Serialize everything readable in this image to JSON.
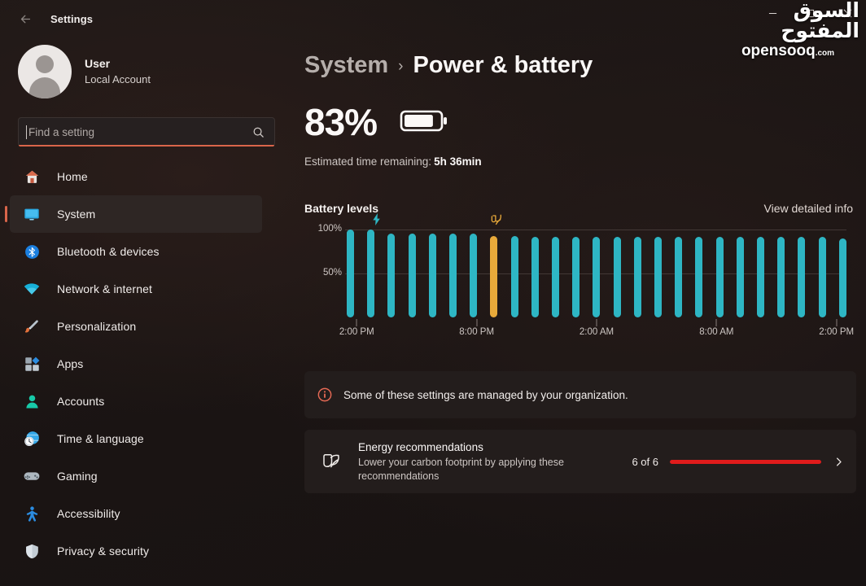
{
  "window": {
    "title": "Settings",
    "back_icon": "back-arrow-icon",
    "controls": [
      {
        "name": "minimize-button",
        "glyph": "─"
      },
      {
        "name": "maximize-button",
        "glyph": "□"
      },
      {
        "name": "close-button",
        "glyph": "✕"
      }
    ]
  },
  "watermark": {
    "arabic": "السوق المفتوح",
    "english": "opensooq",
    "suffix": ".com"
  },
  "sidebar": {
    "account": {
      "name": "User",
      "subtitle": "Local Account",
      "avatar_icon": "user-avatar-icon"
    },
    "search": {
      "placeholder": "Find a setting",
      "value": "",
      "icon": "search-icon"
    },
    "items": [
      {
        "label": "Home",
        "icon": "home-icon",
        "selected": false
      },
      {
        "label": "System",
        "icon": "system-monitor-icon",
        "selected": true
      },
      {
        "label": "Bluetooth & devices",
        "icon": "bluetooth-icon",
        "selected": false
      },
      {
        "label": "Network & internet",
        "icon": "wifi-icon",
        "selected": false
      },
      {
        "label": "Personalization",
        "icon": "paintbrush-icon",
        "selected": false
      },
      {
        "label": "Apps",
        "icon": "apps-icon",
        "selected": false
      },
      {
        "label": "Accounts",
        "icon": "accounts-person-icon",
        "selected": false
      },
      {
        "label": "Time & language",
        "icon": "clock-globe-icon",
        "selected": false
      },
      {
        "label": "Gaming",
        "icon": "gamepad-icon",
        "selected": false
      },
      {
        "label": "Accessibility",
        "icon": "accessibility-person-icon",
        "selected": false
      },
      {
        "label": "Privacy & security",
        "icon": "shield-icon",
        "selected": false
      }
    ]
  },
  "main": {
    "breadcrumb": {
      "parent": "System",
      "separator": "›",
      "current": "Power & battery"
    },
    "battery": {
      "percent_label": "83%",
      "percent_value": 83,
      "icon": "battery-icon",
      "estimate_label": "Estimated time remaining:",
      "estimate_value": "5h 36min"
    },
    "chart_section": {
      "title": "Battery levels",
      "link": "View detailed info"
    },
    "org_banner": {
      "icon": "info-icon",
      "text": "Some of these settings are managed by your organization."
    },
    "energy_card": {
      "icon": "energy-leaf-icon",
      "title": "Energy recommendations",
      "subtitle": "Lower your carbon footprint by applying these recommendations",
      "count": "6 of 6",
      "progress_percent": 100,
      "chevron_icon": "chevron-right-icon"
    }
  },
  "colors": {
    "accent": "#d9654a",
    "bar_teal": "#2eb6c4",
    "bar_amber": "#e8a93a",
    "progress_red": "#e01b1b",
    "info_red": "#e86a55"
  },
  "chart_data": {
    "type": "bar",
    "title": "Battery levels",
    "xlabel": "",
    "ylabel": "",
    "ylim": [
      0,
      100
    ],
    "ytick_labels": [
      "100%",
      "50%"
    ],
    "ytick_values": [
      100,
      50
    ],
    "grid": true,
    "legend": false,
    "xtick_labels": [
      "2:00 PM",
      "8:00 PM",
      "2:00 AM",
      "8:00 AM",
      "2:00 PM"
    ],
    "xtick_indices": [
      0,
      6,
      12,
      18,
      24
    ],
    "categories": [
      "2:00 PM",
      "3:00 PM",
      "4:00 PM",
      "5:00 PM",
      "6:00 PM",
      "7:00 PM",
      "8:00 PM",
      "9:00 PM",
      "10:00 PM",
      "11:00 PM",
      "12:00 AM",
      "1:00 AM",
      "2:00 AM",
      "3:00 AM",
      "4:00 AM",
      "5:00 AM",
      "6:00 AM",
      "7:00 AM",
      "8:00 AM",
      "9:00 AM",
      "10:00 AM",
      "11:00 AM",
      "12:00 PM",
      "1:00 PM",
      "2:00 PM"
    ],
    "values": [
      100,
      100,
      95,
      95,
      95,
      95,
      95,
      93,
      93,
      92,
      92,
      92,
      92,
      92,
      92,
      92,
      92,
      92,
      92,
      92,
      92,
      92,
      92,
      92,
      90
    ],
    "bar_colors": [
      "teal",
      "teal",
      "teal",
      "teal",
      "teal",
      "teal",
      "teal",
      "amber",
      "teal",
      "teal",
      "teal",
      "teal",
      "teal",
      "teal",
      "teal",
      "teal",
      "teal",
      "teal",
      "teal",
      "teal",
      "teal",
      "teal",
      "teal",
      "teal",
      "teal"
    ],
    "annotations": [
      {
        "index": 1,
        "icon": "charging-bolt-icon",
        "color": "#2eb6c4",
        "label": "Charging"
      },
      {
        "index": 7,
        "icon": "energy-saver-leaf-icon",
        "color": "#e8a93a",
        "label": "Energy saver"
      }
    ]
  }
}
